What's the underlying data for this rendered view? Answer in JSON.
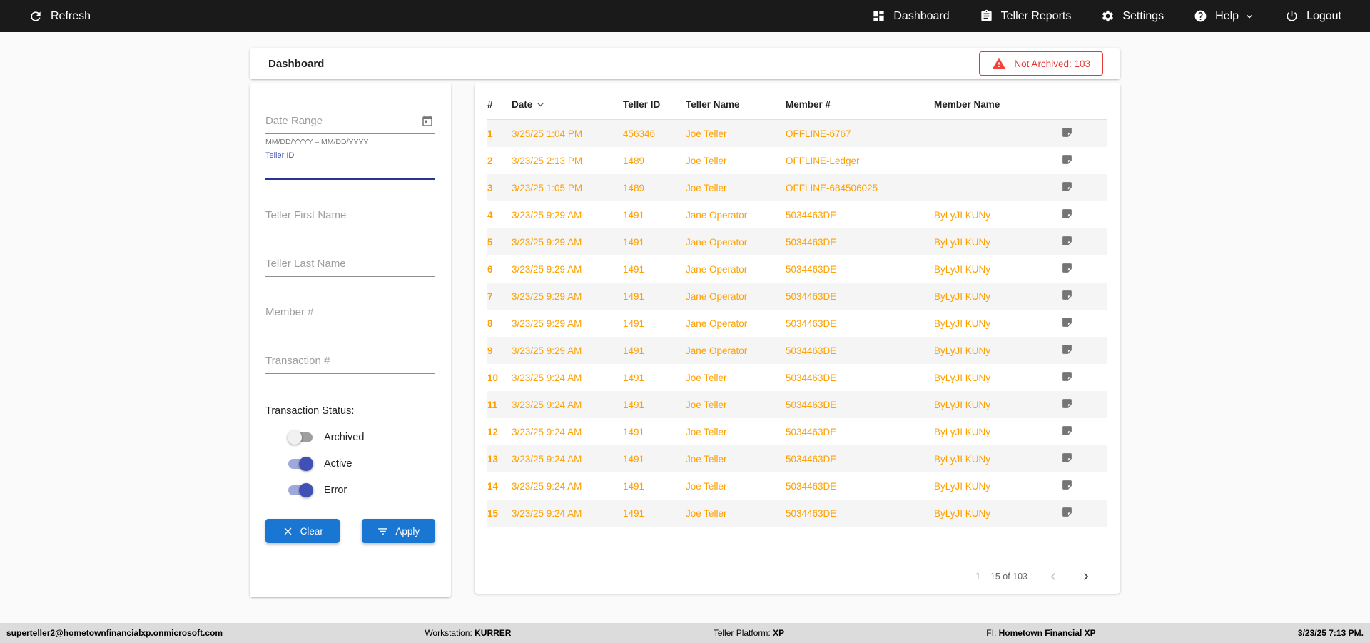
{
  "topbar": {
    "refresh_label": "Refresh",
    "nav": [
      {
        "label": "Dashboard"
      },
      {
        "label": "Teller Reports"
      },
      {
        "label": "Settings"
      },
      {
        "label": "Help"
      },
      {
        "label": "Logout"
      }
    ]
  },
  "header": {
    "title": "Dashboard",
    "not_archived_badge": "Not Archived: 103"
  },
  "filters": {
    "date_range_placeholder": "Date Range",
    "date_range_helper": "MM/DD/YYYY – MM/DD/YYYY",
    "teller_id_label": "Teller ID",
    "teller_first_name_placeholder": "Teller First Name",
    "teller_last_name_placeholder": "Teller Last Name",
    "member_number_placeholder": "Member #",
    "transaction_number_placeholder": "Transaction #",
    "status_label": "Transaction Status:",
    "toggles": [
      {
        "label": "Archived",
        "on": false
      },
      {
        "label": "Active",
        "on": true
      },
      {
        "label": "Error",
        "on": true
      }
    ],
    "clear_label": "Clear",
    "apply_label": "Apply"
  },
  "table": {
    "columns": [
      "#",
      "Date",
      "Teller ID",
      "Teller Name",
      "Member #",
      "Member Name"
    ],
    "rows": [
      {
        "num": "1",
        "date": "3/25/25 1:04 PM",
        "teller_id": "456346",
        "teller_name": "Joe Teller",
        "member": "OFFLINE-6767",
        "member_name": ""
      },
      {
        "num": "2",
        "date": "3/23/25 2:13 PM",
        "teller_id": "1489",
        "teller_name": "Joe Teller",
        "member": "OFFLINE-Ledger",
        "member_name": ""
      },
      {
        "num": "3",
        "date": "3/23/25 1:05 PM",
        "teller_id": "1489",
        "teller_name": "Joe Teller",
        "member": "OFFLINE-684506025",
        "member_name": ""
      },
      {
        "num": "4",
        "date": "3/23/25 9:29 AM",
        "teller_id": "1491",
        "teller_name": "Jane Operator",
        "member": "5034463DE",
        "member_name": "ByLyJI KUNy"
      },
      {
        "num": "5",
        "date": "3/23/25 9:29 AM",
        "teller_id": "1491",
        "teller_name": "Jane Operator",
        "member": "5034463DE",
        "member_name": "ByLyJI KUNy"
      },
      {
        "num": "6",
        "date": "3/23/25 9:29 AM",
        "teller_id": "1491",
        "teller_name": "Jane Operator",
        "member": "5034463DE",
        "member_name": "ByLyJI KUNy"
      },
      {
        "num": "7",
        "date": "3/23/25 9:29 AM",
        "teller_id": "1491",
        "teller_name": "Jane Operator",
        "member": "5034463DE",
        "member_name": "ByLyJI KUNy"
      },
      {
        "num": "8",
        "date": "3/23/25 9:29 AM",
        "teller_id": "1491",
        "teller_name": "Jane Operator",
        "member": "5034463DE",
        "member_name": "ByLyJI KUNy"
      },
      {
        "num": "9",
        "date": "3/23/25 9:29 AM",
        "teller_id": "1491",
        "teller_name": "Jane Operator",
        "member": "5034463DE",
        "member_name": "ByLyJI KUNy"
      },
      {
        "num": "10",
        "date": "3/23/25 9:24 AM",
        "teller_id": "1491",
        "teller_name": "Joe Teller",
        "member": "5034463DE",
        "member_name": "ByLyJI KUNy"
      },
      {
        "num": "11",
        "date": "3/23/25 9:24 AM",
        "teller_id": "1491",
        "teller_name": "Joe Teller",
        "member": "5034463DE",
        "member_name": "ByLyJI KUNy"
      },
      {
        "num": "12",
        "date": "3/23/25 9:24 AM",
        "teller_id": "1491",
        "teller_name": "Joe Teller",
        "member": "5034463DE",
        "member_name": "ByLyJI KUNy"
      },
      {
        "num": "13",
        "date": "3/23/25 9:24 AM",
        "teller_id": "1491",
        "teller_name": "Joe Teller",
        "member": "5034463DE",
        "member_name": "ByLyJI KUNy"
      },
      {
        "num": "14",
        "date": "3/23/25 9:24 AM",
        "teller_id": "1491",
        "teller_name": "Joe Teller",
        "member": "5034463DE",
        "member_name": "ByLyJI KUNy"
      },
      {
        "num": "15",
        "date": "3/23/25 9:24 AM",
        "teller_id": "1491",
        "teller_name": "Joe Teller",
        "member": "5034463DE",
        "member_name": "ByLyJI KUNy"
      }
    ],
    "pagination": "1 – 15 of 103"
  },
  "footer": {
    "user": "superteller2@hometownfinancialxp.onmicrosoft.com",
    "workstation_label": "Workstation:",
    "workstation_value": "KURRER",
    "platform_label": "Teller Platform:",
    "platform_value": "XP",
    "fi_label": "FI:",
    "fi_value": "Hometown Financial XP",
    "datetime": "3/23/25 7:13 PM."
  },
  "colors": {
    "topbar_bg": "#1a1a1a",
    "accent_blue": "#1976d2",
    "row_text_orange": "#ffa000",
    "error_red": "#e53935",
    "toggle_on_blue": "#3f51b5"
  }
}
